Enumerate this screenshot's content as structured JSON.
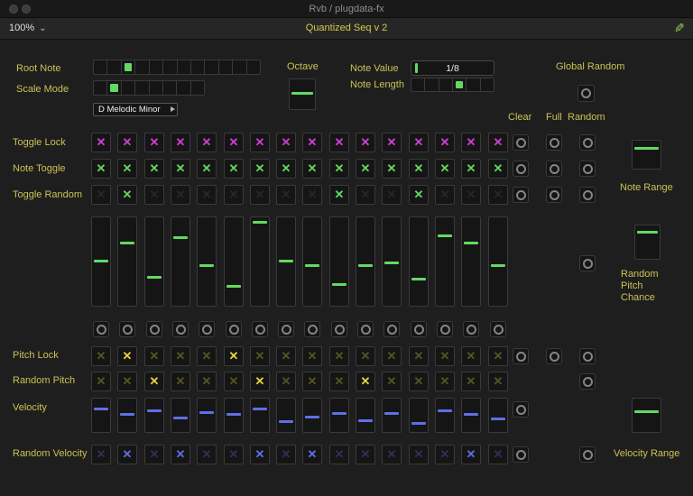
{
  "titlebar": {
    "title": "Rvb / plugdata-fx"
  },
  "toolbar": {
    "zoom_level": "100%",
    "patch_title": "Quantized Seq v 2"
  },
  "labels": {
    "root_note": "Root Note",
    "scale_mode": "Scale Mode",
    "octave": "Octave",
    "note_value": "Note Value",
    "note_length": "Note Length",
    "global_random": "Global Random",
    "clear": "Clear",
    "full": "Full",
    "random": "Random",
    "toggle_lock": "Toggle Lock",
    "note_toggle": "Note Toggle",
    "toggle_random": "Toggle Random",
    "note_range": "Note Range",
    "random_pitch_chance": "Random\nPitch\nChance",
    "pitch_lock": "Pitch Lock",
    "random_pitch": "Random Pitch",
    "velocity": "Velocity",
    "random_velocity": "Random Velocity",
    "velocity_range": "Velocity Range"
  },
  "colors": {
    "accent_green": "#62d962",
    "magenta": "#cf3fd3",
    "yellow": "#e8d33f",
    "blue": "#5f6fe8",
    "label_yellow": "#ccc155"
  },
  "controls": {
    "root_note": {
      "options_count": 12,
      "selected_index": 2
    },
    "scale_mode": {
      "options_count": 8,
      "selected_index": 1
    },
    "note_length": {
      "options_count": 6,
      "selected_index": 3
    },
    "note_value": "1/8",
    "scale_dropdown": "D Melodic Minor",
    "octave": 0.5,
    "note_range": 0.75,
    "random_pitch_chance": 0.85,
    "velocity_range": 0.6
  },
  "sequencer": {
    "steps": 16,
    "rows": {
      "toggle_lock": {
        "color": "magenta",
        "active": [
          0,
          1,
          2,
          3,
          4,
          5,
          6,
          7,
          8,
          9,
          10,
          11,
          12,
          13,
          14,
          15
        ]
      },
      "note_toggle": {
        "color": "accent_green",
        "active": [
          0,
          1,
          2,
          3,
          4,
          5,
          6,
          7,
          8,
          9,
          10,
          11,
          12,
          13,
          14,
          15
        ]
      },
      "toggle_random": {
        "color": "accent_green",
        "active": [
          1,
          9,
          12
        ]
      },
      "pitch_lock": {
        "color": "yellow",
        "active": [
          1,
          5
        ]
      },
      "random_pitch": {
        "color": "yellow",
        "active": [
          2,
          6,
          10
        ]
      },
      "random_velocity": {
        "color": "blue",
        "active": [
          1,
          3,
          6,
          8,
          14
        ]
      }
    },
    "pitch_values": [
      0.5,
      0.72,
      0.3,
      0.78,
      0.45,
      0.2,
      0.97,
      0.5,
      0.45,
      0.22,
      0.45,
      0.48,
      0.28,
      0.8,
      0.72,
      0.45
    ],
    "velocity_values": [
      0.72,
      0.5,
      0.65,
      0.4,
      0.58,
      0.5,
      0.72,
      0.26,
      0.42,
      0.55,
      0.3,
      0.55,
      0.18,
      0.65,
      0.5,
      0.35
    ]
  }
}
